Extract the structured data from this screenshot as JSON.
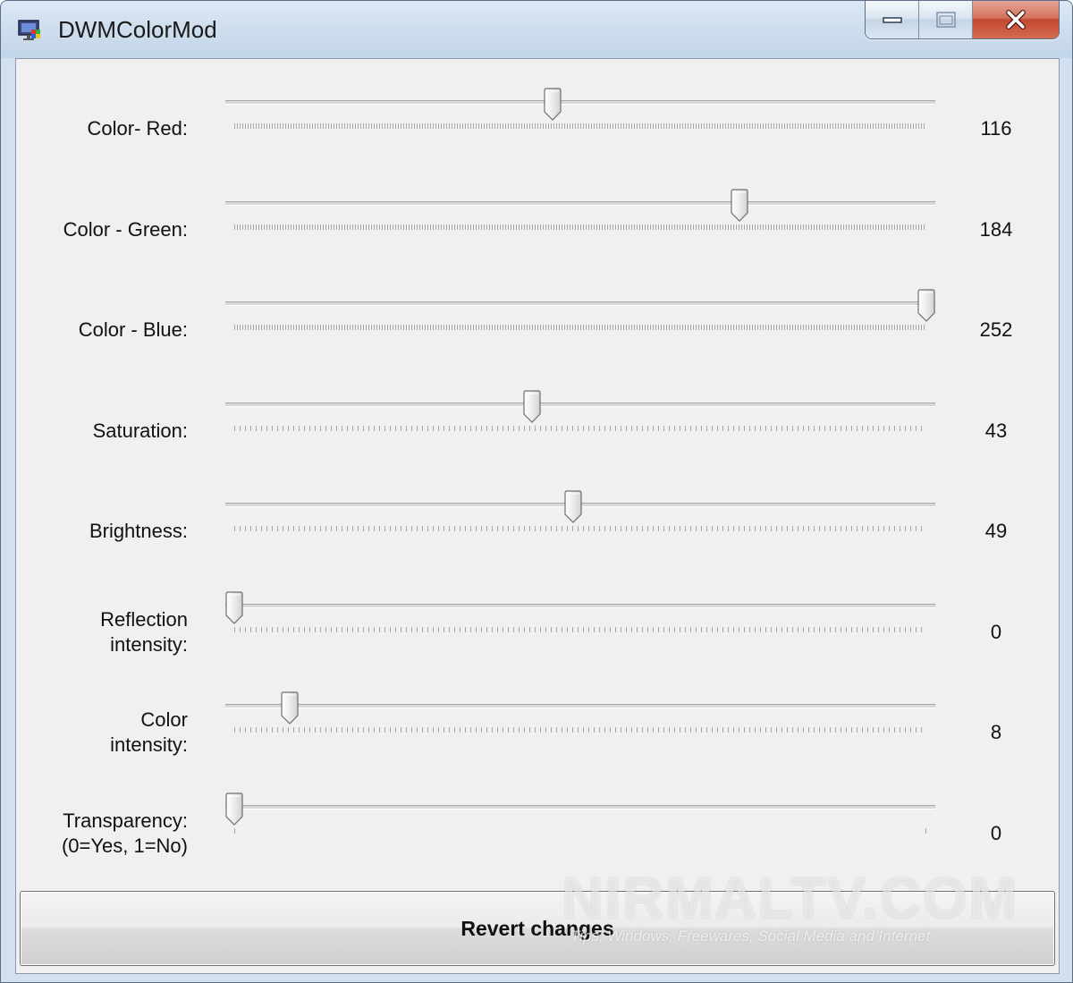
{
  "window": {
    "title": "DWMColorMod"
  },
  "sliders": [
    {
      "label": "Color- Red:",
      "value": "116",
      "fraction": 0.4603,
      "ticks": "dense"
    },
    {
      "label": "Color - Green:",
      "value": "184",
      "fraction": 0.7302,
      "ticks": "dense"
    },
    {
      "label": "Color - Blue:",
      "value": "252",
      "fraction": 1.0,
      "ticks": "dense"
    },
    {
      "label": "Saturation:",
      "value": "43",
      "fraction": 0.43,
      "ticks": "medium"
    },
    {
      "label": "Brightness:",
      "value": "49",
      "fraction": 0.49,
      "ticks": "medium"
    },
    {
      "label": "Reflection\nintensity:",
      "value": "0",
      "fraction": 0.0,
      "ticks": "medium"
    },
    {
      "label": "Color\nintensity:",
      "value": "8",
      "fraction": 0.08,
      "ticks": "medium"
    },
    {
      "label": "Transparency:\n(0=Yes, 1=No)",
      "value": "0",
      "fraction": 0.0,
      "ticks": "ends"
    }
  ],
  "revert_button": {
    "label": "Revert changes"
  },
  "watermark": {
    "main": "NIRMALTV.COM",
    "sub": "Tips, Windows, Freewares, Social Media and Internet"
  },
  "colors": {
    "close_button": "#c44a32",
    "client_background": "#f0f0f0"
  },
  "icons": {
    "app": "monitor-icon",
    "minimize": "minimize-icon",
    "maximize": "maximize-icon",
    "close": "close-icon"
  }
}
